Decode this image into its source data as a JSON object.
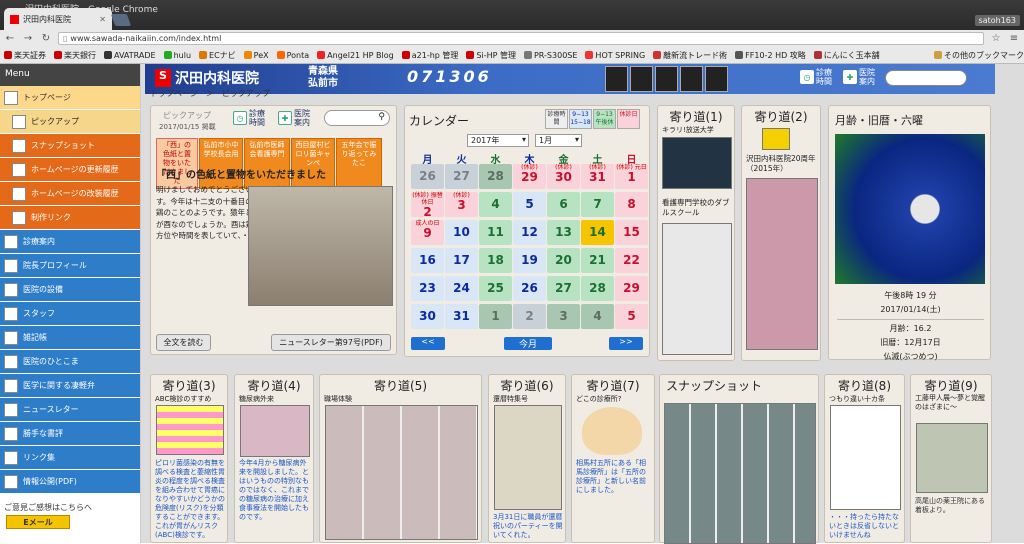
{
  "window": {
    "title": "沢田内科医院 - Google Chrome",
    "tab": "沢田内科医院",
    "user": "satoh163"
  },
  "address": {
    "url": "www.sawada-naikaiin.com/index.html"
  },
  "bookmarks": [
    "楽天証券",
    "楽天銀行",
    "AVATRADE",
    "hulu",
    "ECナビ",
    "PeX",
    "Ponta",
    "Angel21 HP Blog",
    "a21-hp 管理",
    "Si-HP 管理",
    "PR-S300SE",
    "HOT SPRING",
    "離新流トレード術",
    "FF10-2 HD 攻略",
    "にんにく玉本舗",
    "その他のブックマーク"
  ],
  "sidebar": {
    "title": "Menu",
    "items": [
      {
        "label": "トップページ",
        "style": "top"
      },
      {
        "label": "ピックアップ",
        "style": "sub"
      },
      {
        "label": "スナップショット",
        "style": "org"
      },
      {
        "label": "ホームページの更新履歴",
        "style": "org"
      },
      {
        "label": "ホームページの改装履歴",
        "style": "org"
      },
      {
        "label": "制作リンク",
        "style": "org"
      },
      {
        "label": "診療案内",
        "style": "blue"
      },
      {
        "label": "院長プロフィール",
        "style": "blue"
      },
      {
        "label": "医院の設備",
        "style": "blue"
      },
      {
        "label": "スタッフ",
        "style": "blue"
      },
      {
        "label": "雑記帳",
        "style": "blue"
      },
      {
        "label": "医院のひとこま",
        "style": "blue"
      },
      {
        "label": "医学に関する凄軽弁",
        "style": "blue"
      },
      {
        "label": "ニュースレター",
        "style": "blue"
      },
      {
        "label": "勝手な書評",
        "style": "blue"
      },
      {
        "label": "リンク集",
        "style": "blue"
      },
      {
        "label": "情報公開(PDF)",
        "style": "blue"
      }
    ],
    "opinion": "ご意見ご感想はこちらへ",
    "email": "Eメール"
  },
  "header": {
    "logo": "沢田内科医院",
    "pref": "青森県",
    "city": "弘前市",
    "tel": "071306",
    "btn1": "診療時間",
    "btn2": "医院案内"
  },
  "breadcrumb": "トップページ　＞　ピックアップ",
  "pickup": {
    "label": "ピックアップ",
    "date": "2017/01/15 掲載",
    "btn1": "診療時間",
    "btn2": "医院案内",
    "chips": [
      "「西」の色紙と置物をいただきました",
      "弘前市小中学校長会用",
      "弘前市医師会看護専門",
      "西目屋村ビロリ菌キャンペ",
      "五年会で振り返ってみたこ"
    ],
    "title": "「西」の色紙と置物をいただきました",
    "body": "明けましておめでとうございます。今年もよろしくお願いいたします。今年は十二支の十番目の酉年です。酉と書きますが、鳥の中でも鶏のことのようです。猿年と戌年の間なので、犬猿の仲をトリ持つのが酉なのでしょうか。酉は鶏、戌は犬のことですが、本来、十二支は方位や時間を表していて、・・・",
    "readmore": "全文を読む",
    "newsletter": "ニュースレター第97号(PDF)"
  },
  "calendar": {
    "title": "カレンダー",
    "year": "2017年",
    "month": "1月",
    "legend": [
      "診療時間",
      "9−13 15−18",
      "9−13 午後休",
      "休診日"
    ],
    "weekdays": [
      "月",
      "火",
      "水",
      "木",
      "金",
      "土",
      "日"
    ],
    "prev": "<<",
    "today": "今月",
    "next": ">>",
    "rows": [
      [
        {
          "d": "26",
          "s": "gray"
        },
        {
          "d": "27",
          "s": "gray"
        },
        {
          "d": "28",
          "s": "grayg"
        },
        {
          "d": "29",
          "s": "pink",
          "n": "(休診)"
        },
        {
          "d": "30",
          "s": "pink",
          "n": "(休診)"
        },
        {
          "d": "31",
          "s": "pink",
          "n": "(休診)"
        },
        {
          "d": "1",
          "s": "pink",
          "n": "(休診) 元日"
        }
      ],
      [
        {
          "d": "2",
          "s": "pink",
          "n": "(休診) 振替休日"
        },
        {
          "d": "3",
          "s": "pink",
          "n": "(休診)"
        },
        {
          "d": "4",
          "s": "green"
        },
        {
          "d": "5",
          "s": "blue"
        },
        {
          "d": "6",
          "s": "green"
        },
        {
          "d": "7",
          "s": "green"
        },
        {
          "d": "8",
          "s": "pink"
        }
      ],
      [
        {
          "d": "9",
          "s": "pink",
          "n": "成人の日"
        },
        {
          "d": "10",
          "s": "blue"
        },
        {
          "d": "11",
          "s": "green"
        },
        {
          "d": "12",
          "s": "blue"
        },
        {
          "d": "13",
          "s": "green"
        },
        {
          "d": "14",
          "s": "yellow"
        },
        {
          "d": "15",
          "s": "pink"
        }
      ],
      [
        {
          "d": "16",
          "s": "blue"
        },
        {
          "d": "17",
          "s": "blue"
        },
        {
          "d": "18",
          "s": "green"
        },
        {
          "d": "19",
          "s": "blue"
        },
        {
          "d": "20",
          "s": "green"
        },
        {
          "d": "21",
          "s": "green"
        },
        {
          "d": "22",
          "s": "pink"
        }
      ],
      [
        {
          "d": "23",
          "s": "blue"
        },
        {
          "d": "24",
          "s": "blue"
        },
        {
          "d": "25",
          "s": "green"
        },
        {
          "d": "26",
          "s": "blue"
        },
        {
          "d": "27",
          "s": "green"
        },
        {
          "d": "28",
          "s": "green"
        },
        {
          "d": "29",
          "s": "pink"
        }
      ],
      [
        {
          "d": "30",
          "s": "blue"
        },
        {
          "d": "31",
          "s": "blue"
        },
        {
          "d": "1",
          "s": "grayg"
        },
        {
          "d": "2",
          "s": "gray"
        },
        {
          "d": "3",
          "s": "grayg"
        },
        {
          "d": "4",
          "s": "grayg"
        },
        {
          "d": "5",
          "s": "pink"
        }
      ]
    ]
  },
  "yorimichi1": {
    "title": "寄り道(1)",
    "sub": "キラリ!放送大学",
    "caption": "看護専門学校のダブルスクール"
  },
  "yorimichi2": {
    "title": "寄り道(2)",
    "caption": "沢田内科医院20周年（2015年）"
  },
  "moon": {
    "title": "月齢・旧暦・六曜",
    "time": "午後8時 19 分",
    "date": "2017/01/14(土)",
    "age": "月齢：16.2",
    "lunar": "旧暦：12月17日",
    "rokuyo": "仏滅(ぶつめつ)"
  },
  "yorimichi3": {
    "title": "寄り道(3)",
    "sub": "ABC検診のすすめ",
    "text": "ピロリ菌感染の有無を調べる検査と萎縮性胃炎の程度を調べる検査を組み合わせて胃癌になりやすいかどうかの危険度(リスク)を分類することができます。これが胃がんリスク(ABC)検診です。"
  },
  "yorimichi4": {
    "title": "寄り道(4)",
    "sub": "糖尿病外来",
    "text": "今年4月から糖尿病外来を開設しました。とはいうものの特別なものではなく、これまでの糖尿病の治療に加え食事療法を開始したものです。"
  },
  "yorimichi5": {
    "title": "寄り道(5)",
    "sub": "職場体験"
  },
  "yorimichi6": {
    "title": "寄り道(6)",
    "sub": "還暦特集号",
    "text": "3月31日に職員が還暦祝いのパーティーを開いてくれた。"
  },
  "yorimichi7": {
    "title": "寄り道(7)",
    "sub": "どこの診療所?",
    "text": "相馬村五所にある「相馬診療所」は「五所の診療所」と新しい名前にしました。"
  },
  "snapshot": {
    "title": "スナップショット"
  },
  "yorimichi8": {
    "title": "寄り道(8)",
    "sub": "つもり違い十カ条",
    "text": "・・・持ったら持たないときは反省しないといけませんね"
  },
  "yorimichi9": {
    "title": "寄り道(9)",
    "sub": "工藤甲人展～夢と覚醒のはざまに～",
    "text": "高尾山の薬王院にある着板より。"
  }
}
